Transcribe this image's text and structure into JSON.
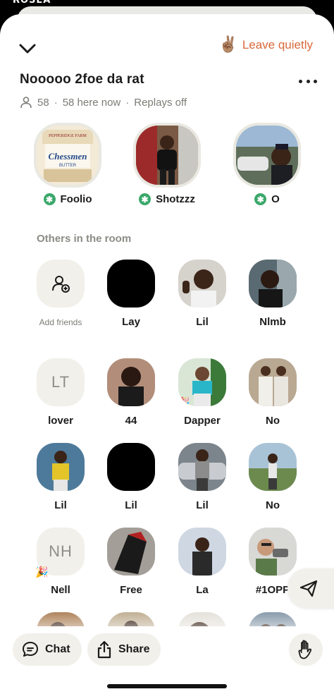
{
  "status_bar": {
    "text": "ROSEA"
  },
  "header": {
    "collapse_icon": "chevron-down-icon",
    "leave_emoji": "✌🏽",
    "leave_label": "Leave quietly"
  },
  "room": {
    "title": "Nooooo 2foe da rat",
    "member_count": "58",
    "here_now": "58 here now",
    "replays": "Replays off"
  },
  "speakers": [
    {
      "name": "Foolio",
      "badge": "✱",
      "photo": "chessmen-butter-cookies"
    },
    {
      "name": "Shotzzz",
      "badge": "✱",
      "photo": "person-in-room"
    },
    {
      "name": "O",
      "badge": "✱",
      "photo": "person-outdoors-with-car"
    }
  ],
  "others_label": "Others in the room",
  "members": [
    {
      "name": "Add friends",
      "type": "add"
    },
    {
      "name": "Lay",
      "type": "photo"
    },
    {
      "name": "Lil",
      "type": "photo"
    },
    {
      "name": "Nlmb",
      "type": "photo"
    },
    {
      "name": "lover",
      "type": "initials",
      "initials": "LT"
    },
    {
      "name": "44",
      "type": "photo"
    },
    {
      "name": "Dapper",
      "type": "photo",
      "badge": "🎉"
    },
    {
      "name": "No",
      "type": "photo"
    },
    {
      "name": "Lil",
      "type": "photo"
    },
    {
      "name": "Lil",
      "type": "photo"
    },
    {
      "name": "Lil",
      "type": "photo"
    },
    {
      "name": "No",
      "type": "photo"
    },
    {
      "name": "Nell",
      "type": "initials",
      "initials": "NH",
      "badge": "🎉"
    },
    {
      "name": "Free",
      "type": "photo"
    },
    {
      "name": "La",
      "type": "photo"
    },
    {
      "name": "#1OPP",
      "type": "photo"
    }
  ],
  "bottom_bar": {
    "chat_label": "Chat",
    "share_label": "Share",
    "raise_hand_icon": "raise-hand-icon"
  },
  "colors": {
    "accent": "#d9683a",
    "speaker_badge": "#3aa86a",
    "pill_bg": "#f1f0ea",
    "text_primary": "#1b1b1b",
    "text_secondary": "#7b7b76"
  }
}
